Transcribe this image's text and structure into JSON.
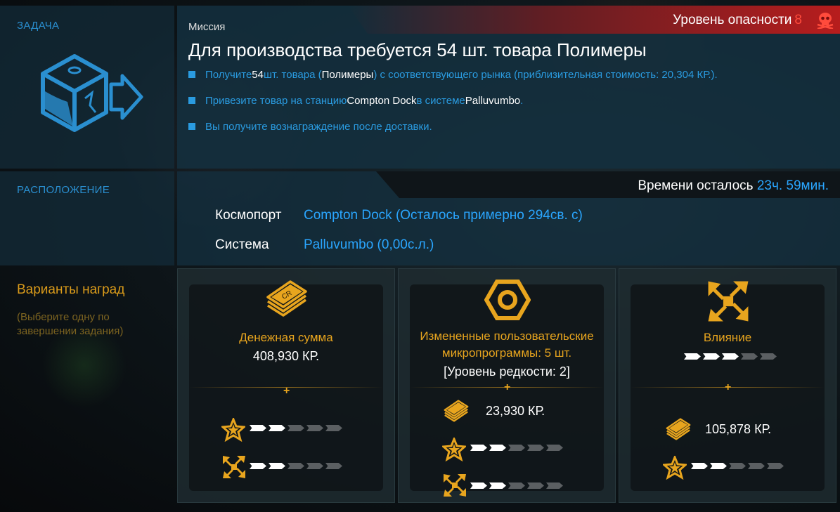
{
  "left_labels": {
    "task": "ЗАДАЧА",
    "location": "РАСПОЛОЖЕНИЕ",
    "rewards": "Варианты наград",
    "rewards_hint": "(Выберите одну по завершении задания)"
  },
  "danger": {
    "label": "Уровень опасности",
    "level": "8"
  },
  "mission": {
    "label": "Миссия",
    "title": "Для производства требуется 54 шт. товара Полимеры",
    "bullet1": {
      "p1": "Получите ",
      "qty": "54",
      "p2": " шт. товара (",
      "item": "Полимеры",
      "p3": ") с соответствующего рынка (приблизительная стоимость: 20,304 КР.)."
    },
    "bullet2": {
      "p1": "Привезите товар на станцию ",
      "station": "Compton Dock",
      "p2": " в системе ",
      "system": "Palluvumbo",
      "p3": "."
    },
    "bullet3": "Вы получите вознаграждение после доставки."
  },
  "location": {
    "time_label": "Времени осталось",
    "time_value": "23ч. 59мин.",
    "spaceport_key": "Космопорт",
    "spaceport_value": "Compton Dock (Осталось примерно 294св. с)",
    "system_key": "Система",
    "system_value": "Palluvumbo (0,00с.л.)"
  },
  "rewards": [
    {
      "title": "Денежная сумма",
      "value": "408,930 КР.",
      "plus": "+",
      "reputation_level": 2,
      "influence_level": 2
    },
    {
      "title_line1": "Измененные пользовательские",
      "title_line2": "микропрограммы: 5 шт.",
      "rarity": "[Уровень редкости: 2]",
      "plus": "+",
      "credits": "23,930 КР.",
      "reputation_level": 2,
      "influence_level": 2
    },
    {
      "title": "Влияние",
      "plus": "+",
      "credits": "105,878 КР.",
      "influence_level": 3,
      "reputation_level": 2
    }
  ],
  "colors": {
    "accent_blue": "#2a9be0",
    "accent_gold": "#e8a51e",
    "danger_red": "#b71d1d"
  },
  "icons": {
    "task": "cargo-box-icon",
    "credits": "credits-stack-icon",
    "firmware": "hex-gear-icon",
    "influence": "influence-arrows-icon",
    "reputation": "reputation-star-icon",
    "danger": "skull-icon"
  }
}
